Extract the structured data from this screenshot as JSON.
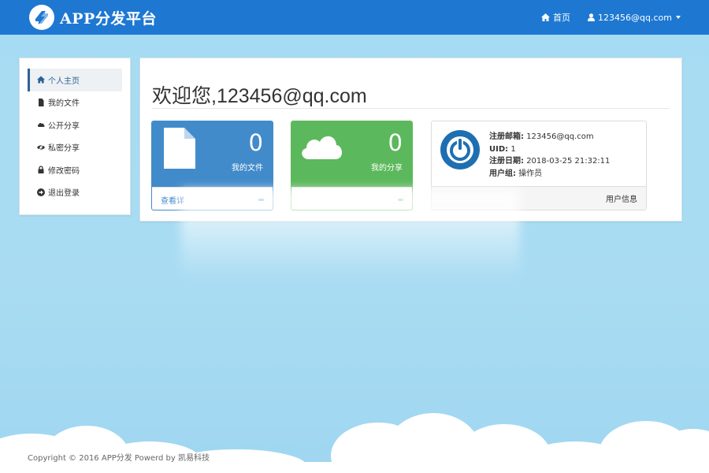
{
  "header": {
    "brand": "APP分发平台",
    "home_label": "首页",
    "user_label": "123456@qq.com"
  },
  "sidebar": {
    "items": [
      {
        "label": "个人主页",
        "icon": "home-icon",
        "active": true
      },
      {
        "label": "我的文件",
        "icon": "file-icon"
      },
      {
        "label": "公开分享",
        "icon": "cloud-icon"
      },
      {
        "label": "私密分享",
        "icon": "eye-slash-icon"
      },
      {
        "label": "修改密码",
        "icon": "lock-icon"
      },
      {
        "label": "退出登录",
        "icon": "arrow-circle-icon"
      }
    ]
  },
  "main": {
    "welcome": "欢迎您,123456@qq.com",
    "cards": [
      {
        "count": "0",
        "label": "我的文件",
        "footer": "查看详",
        "color": "#428bca",
        "icon": "file-icon"
      },
      {
        "count": "0",
        "label": "我的分享",
        "footer": "",
        "color": "#5cb85c",
        "icon": "cloud-icon"
      }
    ],
    "user_card": {
      "email_label": "注册邮箱:",
      "email": "123456@qq.com",
      "uid_label": "UID:",
      "uid": "1",
      "date_label": "注册日期:",
      "date": "2018-03-25 21:32:11",
      "group_label": "用户组:",
      "group": "操作员",
      "footer": "用户信息"
    }
  },
  "footer": {
    "text": "Copyright © 2016 APP分发 Powerd by 凯易科技"
  },
  "colors": {
    "navbar": "#1e78d2",
    "primary": "#428bca",
    "success": "#5cb85c"
  }
}
